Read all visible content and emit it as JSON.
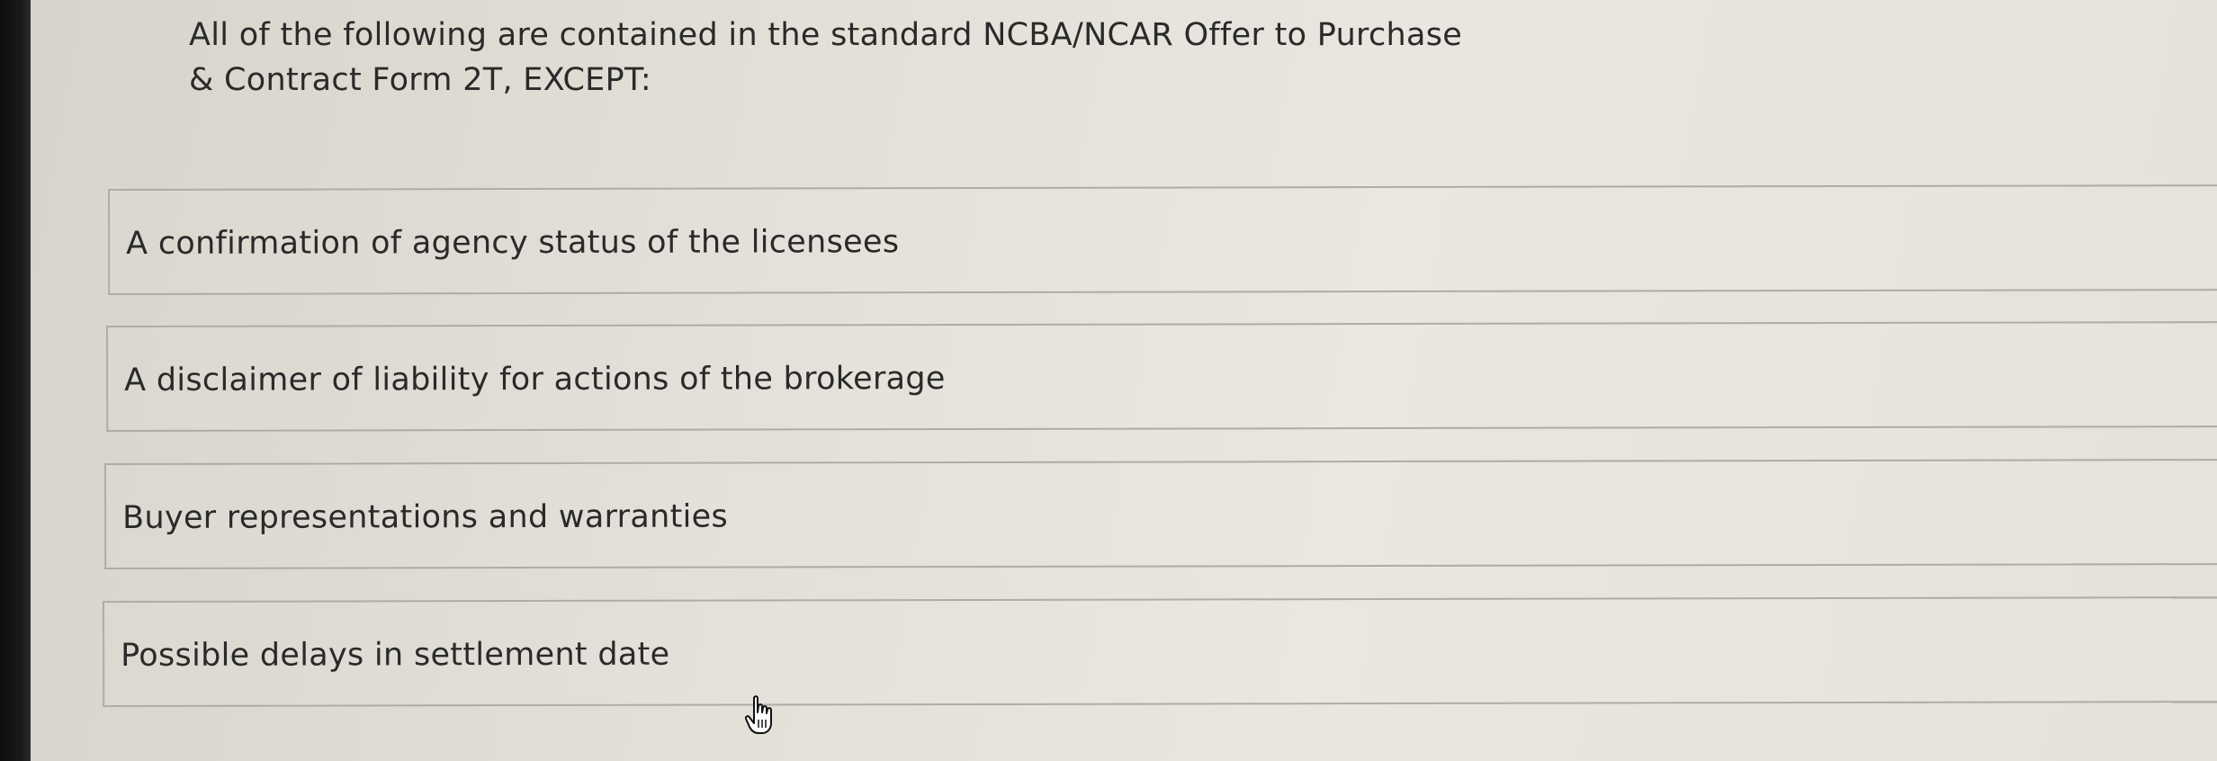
{
  "question": {
    "line1": "All of the following are contained in the standard NCBA/NCAR Offer to Purchase",
    "line2": "& Contract Form 2T, EXCEPT:"
  },
  "options": [
    {
      "label": "A confirmation of agency status of the licensees"
    },
    {
      "label": "A disclaimer of liability for actions of the brokerage"
    },
    {
      "label": "Buyer representations and warranties"
    },
    {
      "label": "Possible delays in settlement date"
    }
  ],
  "colors": {
    "background": "#e3e0d8",
    "text": "#2a2a2a",
    "border": "#aeaca4"
  },
  "cursor_icon": "hand-pointer-icon"
}
